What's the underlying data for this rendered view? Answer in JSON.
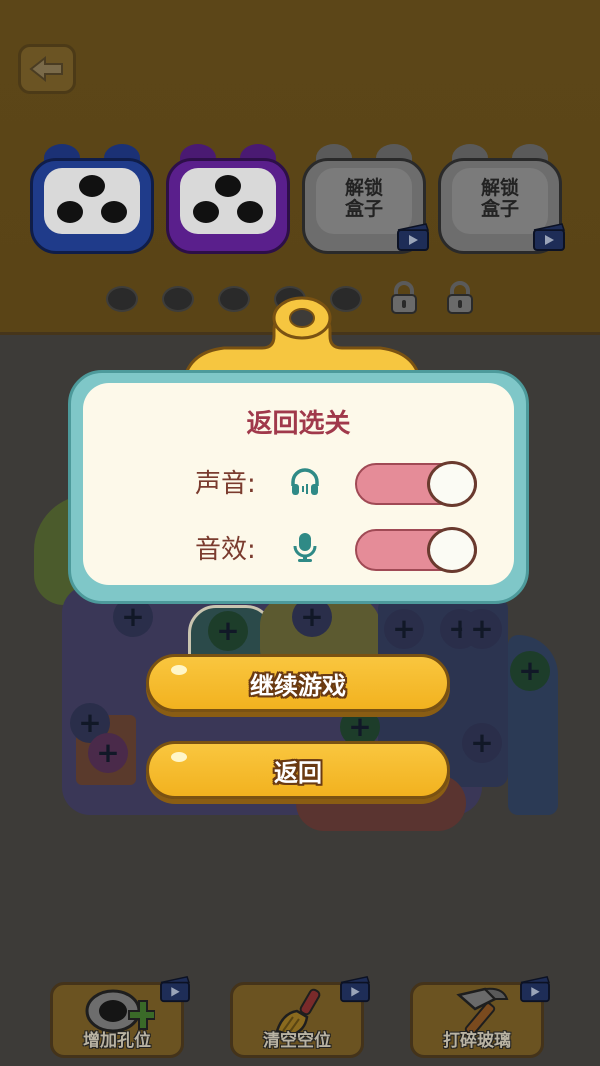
{
  "header": {
    "boxes": [
      {
        "color": "#1f3b8a",
        "state": "unlocked"
      },
      {
        "color": "#5a1f8c",
        "state": "unlocked"
      },
      {
        "state": "locked",
        "label": "解锁\n盒子"
      },
      {
        "state": "locked",
        "label": "解锁\n盒子"
      }
    ],
    "slots_empty": 5,
    "slots_locked": 2
  },
  "dialog": {
    "title": "返回选关",
    "sound_label": "声音:",
    "sound_on": true,
    "effects_label": "音效:",
    "effects_on": true
  },
  "buttons": {
    "continue": "继续游戏",
    "back": "返回"
  },
  "tools": [
    {
      "label": "增加孔位",
      "icon": "add-hole-icon"
    },
    {
      "label": "清空空位",
      "icon": "broom-icon"
    },
    {
      "label": "打碎玻璃",
      "icon": "hammer-icon"
    }
  ],
  "colors": {
    "dialog_frame": "#7fc7c8",
    "dialog_bg": "#fdf9ea",
    "title": "#a0394b",
    "toggle_on": "#e58c98",
    "button": "#f9c63f"
  }
}
